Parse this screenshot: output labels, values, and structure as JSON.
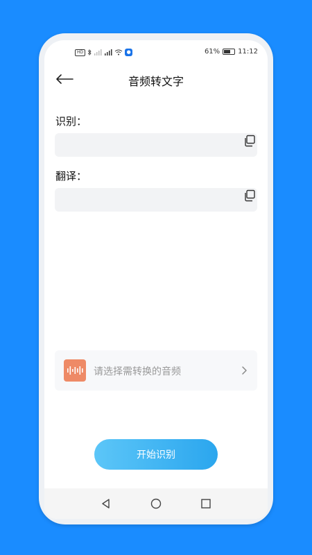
{
  "status_bar": {
    "carrier_badge": "HD",
    "battery_percent": "61%",
    "time": "11:12"
  },
  "header": {
    "title": "音频转文字"
  },
  "recognition": {
    "label": "识别：",
    "value": ""
  },
  "translation": {
    "label": "翻译：",
    "value": ""
  },
  "audio_picker": {
    "placeholder": "请选择需转换的音频"
  },
  "start_button": {
    "label": "开始识别"
  },
  "colors": {
    "background": "#1a8cff",
    "accent_gradient_start": "#5cc6f8",
    "accent_gradient_end": "#2ba6ee",
    "audio_icon_bg": "#ee8a66"
  }
}
